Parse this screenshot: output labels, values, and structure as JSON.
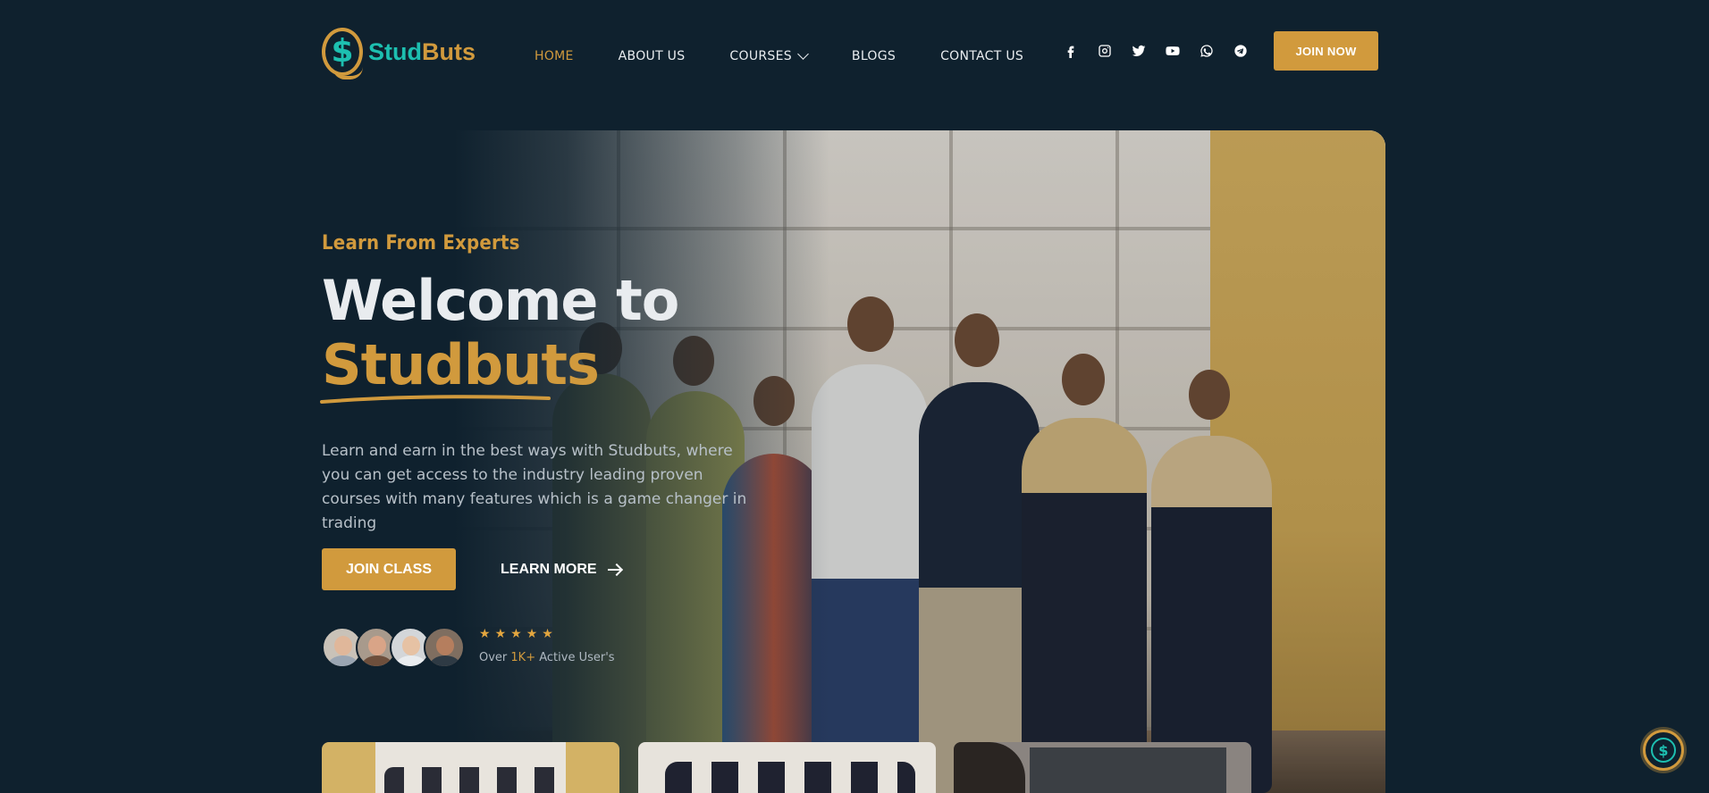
{
  "brand": {
    "name_part1": "Stud",
    "name_part2": "Buts",
    "logo_glyph": "$"
  },
  "nav": {
    "items": [
      {
        "label": "HOME",
        "active": true
      },
      {
        "label": "ABOUT US"
      },
      {
        "label": "COURSES",
        "has_dropdown": true
      },
      {
        "label": "BLOGS"
      },
      {
        "label": "CONTACT US"
      }
    ]
  },
  "social": [
    "facebook-icon",
    "instagram-icon",
    "twitter-icon",
    "youtube-icon",
    "whatsapp-icon",
    "telegram-icon"
  ],
  "header": {
    "join_label": "JOIN NOW"
  },
  "hero": {
    "eyebrow": "Learn From Experts",
    "title_line1": "Welcome to",
    "title_line2": "Studbuts",
    "description": "Learn and earn in the best ways with Studbuts, where you can get access to the industry leading proven courses with many features which is a game changer in trading",
    "join_class_label": "JOIN CLASS",
    "learn_more_label": "LEARN MORE",
    "rating_stars": 5,
    "users_prefix": "Over ",
    "users_count": "1K+",
    "users_suffix": " Active User's"
  },
  "colors": {
    "background": "#0f212e",
    "accent": "#d19a3d",
    "teal": "#1dbfb0"
  }
}
